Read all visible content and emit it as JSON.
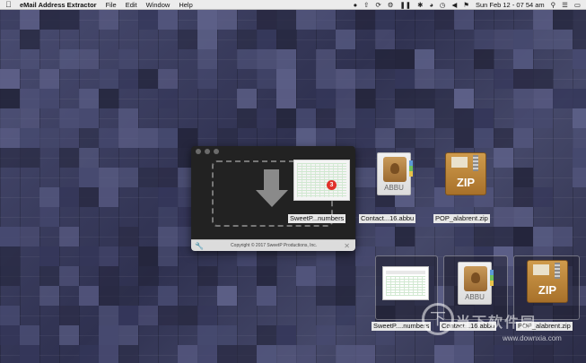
{
  "menubar": {
    "apple_icon": "apple-logo",
    "app_name": "eMail Address Extractor",
    "items": [
      "File",
      "Edit",
      "Window",
      "Help"
    ],
    "status_icons": [
      "user-icon",
      "upload-icon",
      "sync-icon",
      "gear-icon",
      "pause-icon",
      "bluetooth-icon",
      "wifi-icon",
      "time-machine-icon",
      "volume-icon",
      "flag-icon"
    ],
    "clock": "Sun Feb 12 - 07 54 am",
    "right_icons": [
      "search-icon",
      "list-icon",
      "display-icon"
    ]
  },
  "app_window": {
    "drop_badge": "3",
    "thumb_label": "SweetP...numbers",
    "copyright": "Copyright © 2017 SweetP Productions, Inc."
  },
  "desktop_files": [
    {
      "label": "Contact...16.abbu",
      "ext": "ABBU"
    },
    {
      "label": "POP_alabrent.zip",
      "ext": "ZIP"
    }
  ],
  "bottom_files": [
    {
      "label": "SweetP....numbers"
    },
    {
      "label": "Contact...16.abbu",
      "ext": "ABBU"
    },
    {
      "label": "POP_alabrent.zip",
      "ext": "ZIP"
    }
  ],
  "watermark": {
    "logo": "下",
    "text": "当下软件园",
    "url": "www.downxia.com"
  },
  "colors": {
    "wallpaper": "#3b3d5c",
    "badge": "#e0312b",
    "zip": "#c08a3e"
  }
}
